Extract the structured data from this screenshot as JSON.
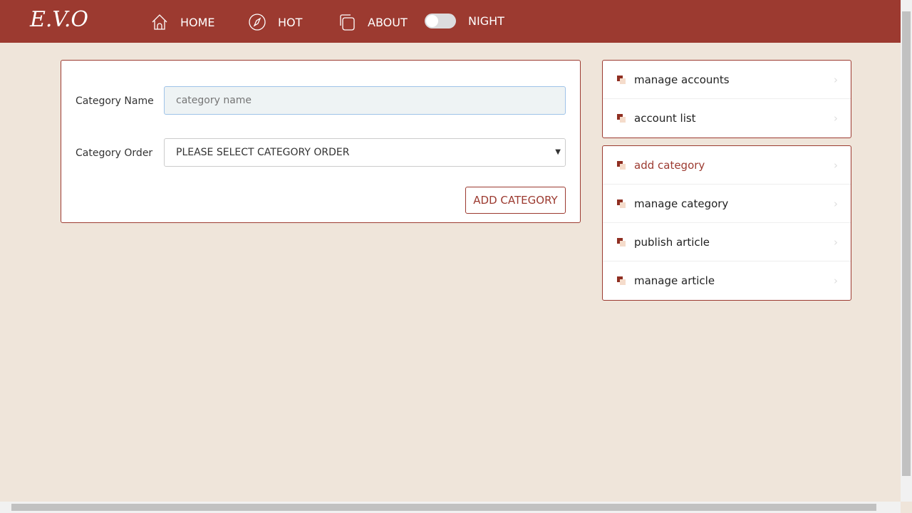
{
  "nav": {
    "logo": "E.V.O",
    "home": "HOME",
    "hot": "HOT",
    "about": "ABOUT",
    "night": "NIGHT",
    "night_on": false
  },
  "form": {
    "name_label": "Category Name",
    "name_placeholder": "category name",
    "order_label": "Category Order",
    "order_value": "PLEASE SELECT CATEGORY ORDER",
    "submit": "ADD CATEGORY"
  },
  "sidebar": {
    "group1": [
      {
        "label": "manage accounts"
      },
      {
        "label": "account list"
      }
    ],
    "group2": [
      {
        "label": "add category",
        "active": true
      },
      {
        "label": "manage category"
      },
      {
        "label": "publish article"
      },
      {
        "label": "manage article"
      }
    ]
  },
  "colors": {
    "brand": "#9c3a30",
    "background": "#efe5da"
  }
}
